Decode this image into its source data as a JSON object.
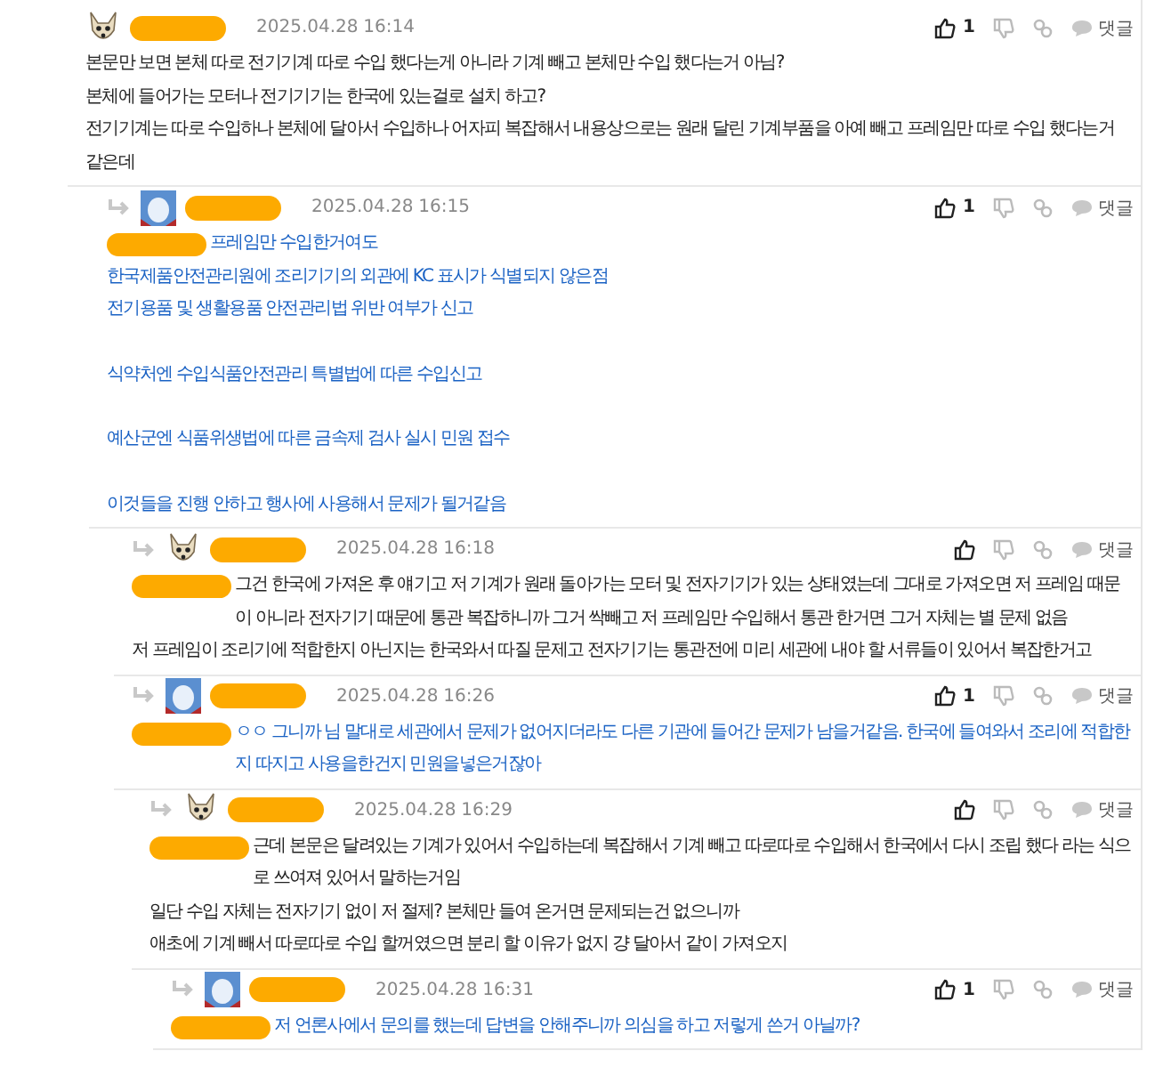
{
  "comments": [
    {
      "avatar": {
        "kind": "dog"
      },
      "date": "2025.04.28 16:14",
      "likes": "1",
      "reply_label": "댓글",
      "color": "#222222",
      "paragraphs": [
        [
          "본문만 보면 본체 따로 전기기계 따로 수입 했다는게 아니라 기계 빼고 본체만 수입 했다는거 아님?",
          "본체에 들어가는 모터나 전기기기는 한국에 있는걸로 설치 하고?",
          "전기기계는 따로 수입하나 본체에 달아서 수입하나 어자피 복잡해서 내용상으로는 원래 달린 기계부품을 아예 빼고 프레임만 따로 수입 했다는거 같은데"
        ]
      ],
      "children": [
        {
          "avatar": {
            "kind": "photo"
          },
          "date": "2025.04.28 16:15",
          "likes": "1",
          "reply_label": "댓글",
          "color": "#1a62c4",
          "redacted_prefix": true,
          "paragraphs": [
            [
              "프레임만 수입한거여도",
              "한국제품안전관리원에 조리기기의 외관에 KC 표시가 식별되지 않은점",
              "전기용품 및 생활용품 안전관리법 위반 여부가 신고"
            ],
            [
              "식약처엔 수입식품안전관리 특별법에 따른 수입신고"
            ],
            [
              "예산군엔 식품위생법에 따른 금속제 검사 실시 민원 접수"
            ],
            [
              "이것들을 진행 안하고 행사에 사용해서 문제가 될거같음"
            ]
          ],
          "children": [
            {
              "avatar": {
                "kind": "dog"
              },
              "date": "2025.04.28 16:18",
              "reply_label": "댓글",
              "color": "#222222",
              "redacted_prefix": true,
              "paragraphs": [
                [
                  "그건 한국에 가져온 후 얘기고 저 기계가 원래 돌아가는 모터 및 전자기기가 있는 상태였는데 그대로 가져오면 저 프레임 때문이 아니라 전자기기 때문에 통관 복잡하니까 그거 싹빼고 저 프레임만 수입해서 통관 한거면 그거 자체는 별 문제 없음",
                  "저 프레임이 조리기에 적합한지 아닌지는 한국와서 따질 문제고 전자기기는 통관전에 미리 세관에 내야 할 서류들이 있어서 복잡한거고"
                ]
              ]
            },
            {
              "avatar": {
                "kind": "photo"
              },
              "date": "2025.04.28 16:26",
              "likes": "1",
              "reply_label": "댓글",
              "color": "#1a62c4",
              "redacted_prefix": true,
              "paragraphs": [
                [
                  "ㅇㅇ 그니까 님 말대로 세관에서 문제가 없어지더라도 다른 기관에 들어간 문제가 남을거같음. 한국에 들여와서 조리에 적합한지 따지고 사용을한건지 민원을넣은거잖아"
                ]
              ],
              "children": [
                {
                  "avatar": {
                    "kind": "dog"
                  },
                  "date": "2025.04.28 16:29",
                  "reply_label": "댓글",
                  "color": "#222222",
                  "redacted_prefix": true,
                  "paragraphs": [
                    [
                      "근데 본문은 달려있는 기계가 있어서 수입하는데 복잡해서 기계 빼고 따로따로 수입해서 한국에서 다시 조립 했다 라는 식으로 쓰여져 있어서 말하는거임",
                      "일단 수입 자체는 전자기기 없이 저 절제? 본체만 들여 온거면 문제되는건 없으니까",
                      "애초에 기계 빼서 따로따로 수입 할꺼였으면 분리 할 이유가 없지 걍 달아서 같이 가져오지"
                    ]
                  ],
                  "children": [
                    {
                      "avatar": {
                        "kind": "photo"
                      },
                      "date": "2025.04.28 16:31",
                      "likes": "1",
                      "reply_label": "댓글",
                      "color": "#1a62c4",
                      "redacted_prefix": true,
                      "paragraphs": [
                        [
                          "저 언론사에서 문의를 했는데 답변을 안해주니까 의심을 하고 저렇게 쓴거 아닐까?"
                        ]
                      ]
                    }
                  ]
                }
              ]
            }
          ]
        }
      ]
    }
  ]
}
